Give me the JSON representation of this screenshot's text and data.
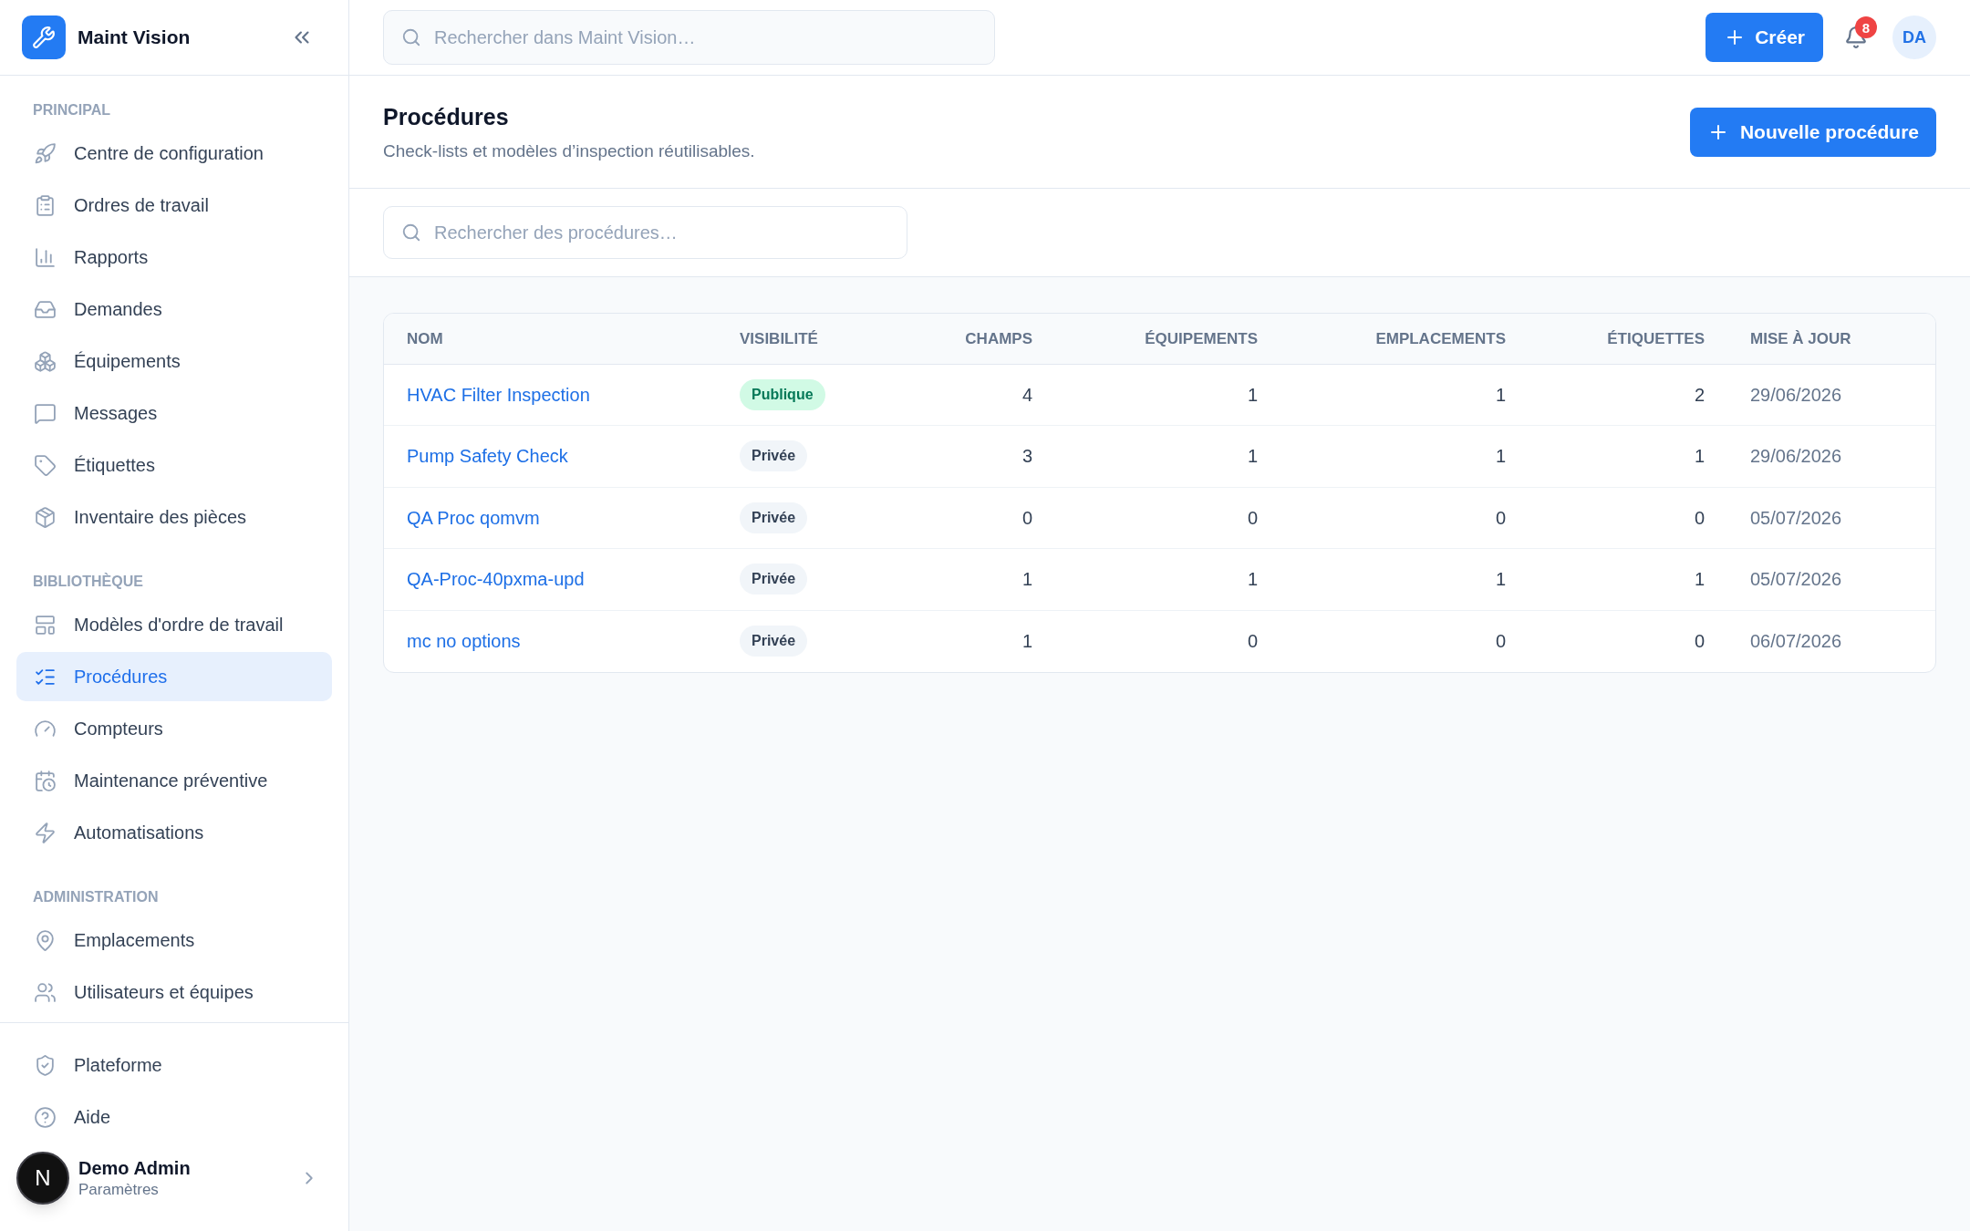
{
  "app": {
    "name": "Maint Vision"
  },
  "sidebar": {
    "sections": [
      {
        "title": "PRINCIPAL",
        "items": [
          {
            "label": "Centre de configuration",
            "selected": false
          },
          {
            "label": "Ordres de travail",
            "selected": false
          },
          {
            "label": "Rapports",
            "selected": false
          },
          {
            "label": "Demandes",
            "selected": false
          },
          {
            "label": "Équipements",
            "selected": false
          },
          {
            "label": "Messages",
            "selected": false
          },
          {
            "label": "Étiquettes",
            "selected": false
          },
          {
            "label": "Inventaire des pièces",
            "selected": false
          }
        ]
      },
      {
        "title": "BIBLIOTHÈQUE",
        "items": [
          {
            "label": "Modèles d'ordre de travail",
            "selected": false
          },
          {
            "label": "Procédures",
            "selected": true
          },
          {
            "label": "Compteurs",
            "selected": false
          },
          {
            "label": "Maintenance préventive",
            "selected": false
          },
          {
            "label": "Automatisations",
            "selected": false
          }
        ]
      },
      {
        "title": "ADMINISTRATION",
        "items": [
          {
            "label": "Emplacements",
            "selected": false
          },
          {
            "label": "Utilisateurs et équipes",
            "selected": false
          }
        ]
      }
    ],
    "footer_items": [
      {
        "label": "Plateforme",
        "selected": false
      },
      {
        "label": "Aide",
        "selected": false
      }
    ],
    "user": {
      "avatar": "N",
      "name": "Demo Admin",
      "subtitle": "Paramètres"
    }
  },
  "topbar": {
    "search": {
      "placeholder": "Rechercher dans Maint Vision…"
    },
    "create_button": "Créer",
    "notifications": {
      "count": "8"
    },
    "avatar": "DA"
  },
  "page": {
    "title": "Procédures",
    "subtitle": "Check-lists et modèles d’inspection réutilisables.",
    "new_button": "Nouvelle procédure",
    "search": {
      "placeholder": "Rechercher des procédures…"
    }
  },
  "table": {
    "columns": [
      "NOM",
      "VISIBILITÉ",
      "CHAMPS",
      "ÉQUIPEMENTS",
      "EMPLACEMENTS",
      "ÉTIQUETTES",
      "MISE À JOUR"
    ],
    "rows": [
      {
        "name": "HVAC Filter Inspection",
        "visibility": {
          "label": "Publique",
          "kind": "public"
        },
        "fields": "4",
        "equipment": "1",
        "locations": "1",
        "tags": "2",
        "updated": "29/06/2026"
      },
      {
        "name": "Pump Safety Check",
        "visibility": {
          "label": "Privée",
          "kind": "private"
        },
        "fields": "3",
        "equipment": "1",
        "locations": "1",
        "tags": "1",
        "updated": "29/06/2026"
      },
      {
        "name": "QA Proc qomvm",
        "visibility": {
          "label": "Privée",
          "kind": "private"
        },
        "fields": "0",
        "equipment": "0",
        "locations": "0",
        "tags": "0",
        "updated": "05/07/2026"
      },
      {
        "name": "QA-Proc-40pxma-upd",
        "visibility": {
          "label": "Privée",
          "kind": "private"
        },
        "fields": "1",
        "equipment": "1",
        "locations": "1",
        "tags": "1",
        "updated": "05/07/2026"
      },
      {
        "name": "mc no options",
        "visibility": {
          "label": "Privée",
          "kind": "private"
        },
        "fields": "1",
        "equipment": "0",
        "locations": "0",
        "tags": "0",
        "updated": "06/07/2026"
      }
    ]
  }
}
